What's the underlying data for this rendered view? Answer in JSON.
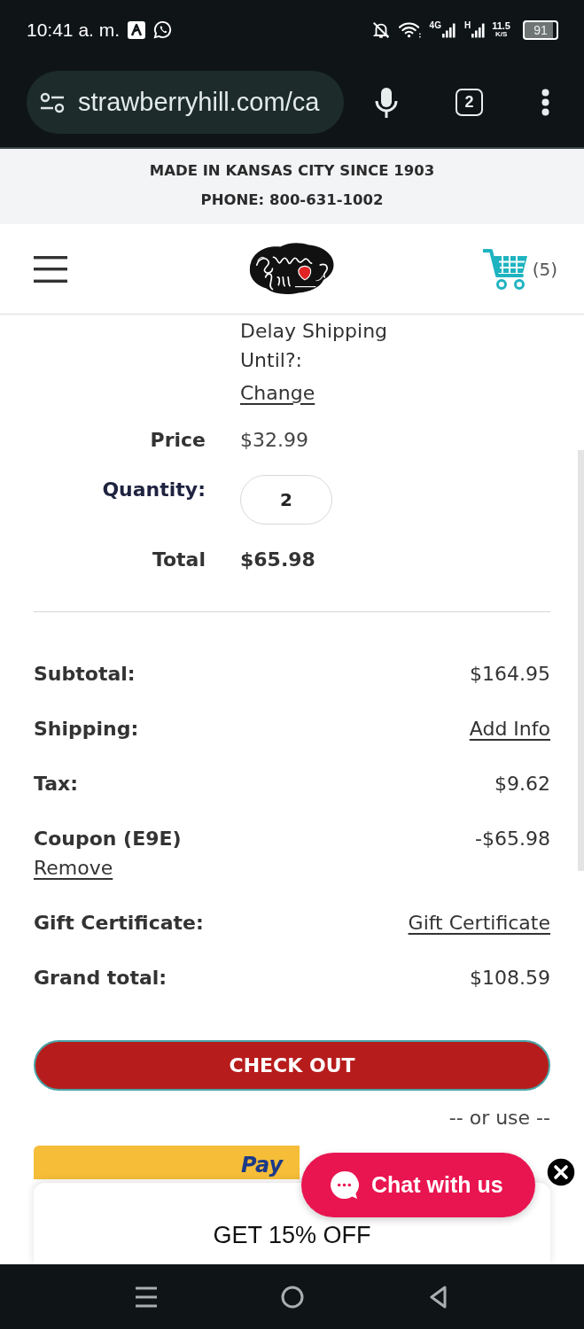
{
  "status_bar": {
    "time": "10:41 a. m.",
    "network_1": "4G",
    "network_2": "H",
    "data_rate": "11.5",
    "data_rate_unit": "K/S",
    "battery": "91"
  },
  "browser": {
    "url": "strawberryhill.com/ca",
    "tab_count": "2"
  },
  "announcement": [
    "MADE IN KANSAS CITY SINCE 1903",
    "PHONE: 800-631-1002"
  ],
  "header": {
    "cart_count": "(5)"
  },
  "cart_item": {
    "option_label": "Delay Shipping Until?:",
    "change_link": "Change",
    "fields": [
      {
        "label": "Price",
        "value": "$32.99",
        "kind": "text"
      },
      {
        "label": "Quantity:",
        "value": "2",
        "kind": "input"
      },
      {
        "label": "Total",
        "value": "$65.98",
        "kind": "total"
      }
    ]
  },
  "summary": [
    {
      "label": "Subtotal:",
      "value": "$164.95",
      "kind": "text"
    },
    {
      "label": "Shipping:",
      "value": "Add Info",
      "kind": "link"
    },
    {
      "label": "Tax:",
      "value": "$9.62",
      "kind": "text"
    },
    {
      "label": "Coupon (E9E)",
      "value": "-$65.98",
      "kind": "text",
      "action": "Remove"
    },
    {
      "label": "Gift Certificate:",
      "value": "Gift Certificate",
      "kind": "link"
    },
    {
      "label": "Grand total:",
      "value": "$108.59",
      "kind": "text"
    }
  ],
  "checkout_button": "CHECK OUT",
  "alt_payment": {
    "divider": "-- or use --",
    "paypal_text": "Pay"
  },
  "promo_popup": {
    "title": "GET 15% OFF"
  },
  "chat_button": {
    "label": "Chat with us"
  }
}
